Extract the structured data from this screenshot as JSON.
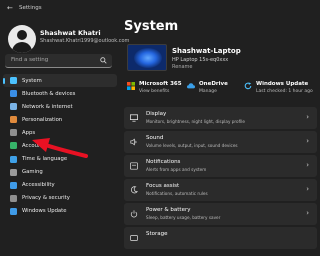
{
  "window": {
    "title": "Settings"
  },
  "profile": {
    "name": "Shashwat Khatri",
    "email": "Shashwat.Khatri1999@outlook.com"
  },
  "search": {
    "placeholder": "Find a setting"
  },
  "nav": {
    "items": [
      {
        "label": "System",
        "icon": "system-icon",
        "color": "#4cc2ff",
        "active": true
      },
      {
        "label": "Bluetooth & devices",
        "icon": "bluetooth-icon",
        "color": "#3a8ee6"
      },
      {
        "label": "Network & internet",
        "icon": "network-icon",
        "color": "#7ab3e6"
      },
      {
        "label": "Personalization",
        "icon": "brush-icon",
        "color": "#e08a3c"
      },
      {
        "label": "Apps",
        "icon": "apps-icon",
        "color": "#8f8f8f"
      },
      {
        "label": "Accounts",
        "icon": "accounts-icon",
        "color": "#37b36a"
      },
      {
        "label": "Time & language",
        "icon": "time-language-icon",
        "color": "#3fa1e8"
      },
      {
        "label": "Gaming",
        "icon": "gaming-icon",
        "color": "#9a9a9a"
      },
      {
        "label": "Accessibility",
        "icon": "accessibility-icon",
        "color": "#3f9be8"
      },
      {
        "label": "Privacy & security",
        "icon": "shield-icon",
        "color": "#8f8f8f"
      },
      {
        "label": "Windows Update",
        "icon": "windows-update-icon",
        "color": "#3f9be8"
      }
    ]
  },
  "main": {
    "title": "System",
    "device": {
      "name": "Shashwat-Laptop",
      "model": "HP Laptop 15s-eq0xxx",
      "rename": "Rename"
    },
    "quick_status": [
      {
        "title": "Microsoft 365",
        "sub": "View benefits",
        "icon": "microsoft-365-icon"
      },
      {
        "title": "OneDrive",
        "sub": "Manage",
        "icon": "onedrive-icon"
      },
      {
        "title": "Windows Update",
        "sub": "Last checked: 1 hour ago",
        "icon": "windows-update-icon"
      }
    ],
    "cards": [
      {
        "title": "Display",
        "sub": "Monitors, brightness, night light, display profile",
        "icon": "display-icon"
      },
      {
        "title": "Sound",
        "sub": "Volume levels, output, input, sound devices",
        "icon": "sound-icon"
      },
      {
        "title": "Notifications",
        "sub": "Alerts from apps and system",
        "icon": "notifications-icon"
      },
      {
        "title": "Focus assist",
        "sub": "Notifications, automatic rules",
        "icon": "focus-assist-icon"
      },
      {
        "title": "Power & battery",
        "sub": "Sleep, battery usage, battery saver",
        "icon": "power-icon"
      },
      {
        "title": "Storage",
        "sub": "",
        "icon": "storage-icon"
      }
    ]
  },
  "colors": {
    "background": "#202020",
    "card": "#2b2b2b",
    "accent": "#4cc2ff",
    "annotation_arrow": "#e81123"
  }
}
